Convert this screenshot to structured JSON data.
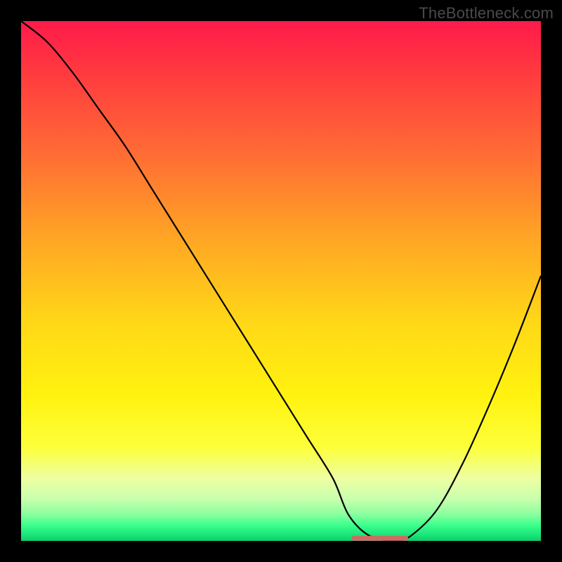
{
  "watermark": "TheBottleneck.com",
  "chart_data": {
    "type": "line",
    "title": "",
    "xlabel": "",
    "ylabel": "",
    "xlim": [
      0,
      100
    ],
    "ylim": [
      0,
      100
    ],
    "x": [
      0,
      5,
      10,
      15,
      20,
      25,
      30,
      35,
      40,
      45,
      50,
      55,
      60,
      63,
      67,
      72,
      75,
      80,
      85,
      90,
      95,
      100
    ],
    "values": [
      100,
      96,
      90,
      83,
      76,
      68,
      60,
      52,
      44,
      36,
      28,
      20,
      12,
      5,
      1,
      0,
      1,
      6,
      15,
      26,
      38,
      51
    ],
    "flat_segment": {
      "x_start": 64,
      "x_end": 74,
      "y": 0.5,
      "color": "#cf6a62"
    },
    "background_gradient": {
      "stops": [
        {
          "pos": 0.0,
          "color": "#ff1a4a"
        },
        {
          "pos": 0.25,
          "color": "#ff6a35"
        },
        {
          "pos": 0.5,
          "color": "#ffc61c"
        },
        {
          "pos": 0.75,
          "color": "#fff20f"
        },
        {
          "pos": 0.92,
          "color": "#c9ffad"
        },
        {
          "pos": 1.0,
          "color": "#14c76b"
        }
      ]
    }
  }
}
